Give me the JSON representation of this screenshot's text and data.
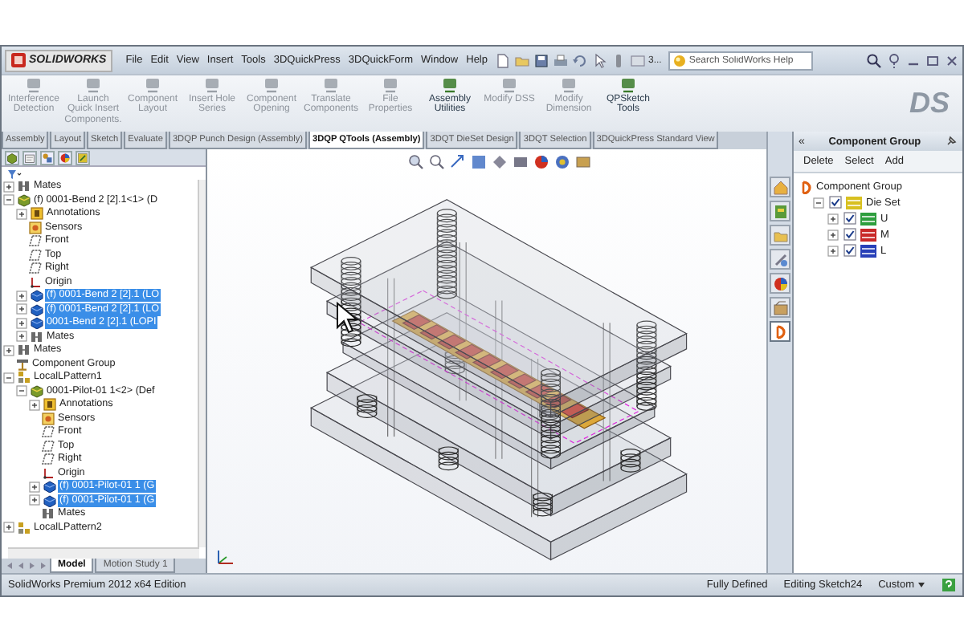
{
  "titlebar": {
    "logo": "SOLIDWORKS",
    "menu": [
      "File",
      "Edit",
      "View",
      "Insert",
      "Tools",
      "3DQuickPress",
      "3DQuickForm",
      "Window",
      "Help"
    ],
    "quick_access_text": "3...",
    "search": {
      "placeholder": "Search SolidWorks Help"
    }
  },
  "ribbon": {
    "commands": [
      {
        "label": "Interference Detection",
        "disabled": true
      },
      {
        "label": "Launch Quick Insert Components.",
        "disabled": true
      },
      {
        "label": "Component Layout",
        "disabled": true
      },
      {
        "label": "Insert Hole Series",
        "disabled": true
      },
      {
        "label": "Component Opening",
        "disabled": true
      },
      {
        "label": "Translate Components",
        "disabled": true
      },
      {
        "label": "File Properties",
        "disabled": true
      },
      {
        "label": "Assembly Utilities",
        "disabled": false
      },
      {
        "label": "Modify DSS",
        "disabled": true
      },
      {
        "label": "Modify Dimension",
        "disabled": true
      },
      {
        "label": "QPSketch Tools",
        "disabled": false
      }
    ],
    "brand_mark": "DS"
  },
  "tabs": [
    {
      "label": "Assembly",
      "selected": false
    },
    {
      "label": "Layout",
      "selected": false
    },
    {
      "label": "Sketch",
      "selected": false
    },
    {
      "label": "Evaluate",
      "selected": false
    },
    {
      "label": "3DQP Punch Design (Assembly)",
      "selected": false
    },
    {
      "label": "3DQP QTools (Assembly)",
      "selected": true
    },
    {
      "label": "3DQT DieSet Design",
      "selected": false
    },
    {
      "label": "3DQT Selection",
      "selected": false
    },
    {
      "label": "3DQuickPress Standard View",
      "selected": false
    }
  ],
  "feature_tree": {
    "items": [
      {
        "label": "Mates",
        "kind": "mates",
        "selected": false,
        "expanded": false
      },
      {
        "label": "(f) 0001-Bend 2 [2].1<1> (D",
        "kind": "assembly",
        "selected": false,
        "expanded": true,
        "children": [
          {
            "label": "Annotations",
            "kind": "annotations",
            "selected": false,
            "expanded": false
          },
          {
            "label": "Sensors",
            "kind": "sensors",
            "selected": false
          },
          {
            "label": "Front",
            "kind": "plane",
            "selected": false
          },
          {
            "label": "Top",
            "kind": "plane",
            "selected": false
          },
          {
            "label": "Right",
            "kind": "plane",
            "selected": false
          },
          {
            "label": "Origin",
            "kind": "origin",
            "selected": false
          },
          {
            "label": "(f) 0001-Bend 2 [2].1 (LO",
            "kind": "part",
            "selected": true,
            "expanded": false
          },
          {
            "label": "(f) 0001-Bend 2 [2].1 (LO",
            "kind": "part",
            "selected": true,
            "expanded": false
          },
          {
            "label": "0001-Bend 2 [2].1 (LOPI",
            "kind": "part",
            "selected": true,
            "expanded": false
          },
          {
            "label": "Mates",
            "kind": "mates",
            "selected": false,
            "expanded": false
          }
        ]
      },
      {
        "label": "Mates",
        "kind": "mates",
        "selected": false,
        "expanded": false
      },
      {
        "label": "Component Group",
        "kind": "group",
        "selected": false
      },
      {
        "label": "LocalLPattern1",
        "kind": "pattern",
        "selected": false,
        "expanded": true,
        "children": [
          {
            "label": "0001-Pilot-01 1<2> (Def",
            "kind": "assembly",
            "selected": false,
            "expanded": true,
            "children": [
              {
                "label": "Annotations",
                "kind": "annotations",
                "selected": false,
                "expanded": false
              },
              {
                "label": "Sensors",
                "kind": "sensors",
                "selected": false
              },
              {
                "label": "Front",
                "kind": "plane",
                "selected": false
              },
              {
                "label": "Top",
                "kind": "plane",
                "selected": false
              },
              {
                "label": "Right",
                "kind": "plane",
                "selected": false
              },
              {
                "label": "Origin",
                "kind": "origin",
                "selected": false
              },
              {
                "label": "(f) 0001-Pilot-01 1 (G",
                "kind": "part",
                "selected": true,
                "expanded": false
              },
              {
                "label": "(f) 0001-Pilot-01 1 (G",
                "kind": "part",
                "selected": true,
                "expanded": false
              },
              {
                "label": "Mates",
                "kind": "mates",
                "selected": false
              }
            ]
          }
        ]
      },
      {
        "label": "LocalLPattern2",
        "kind": "pattern",
        "selected": false,
        "expanded": false
      }
    ]
  },
  "bottom_tabs": [
    {
      "label": "Model",
      "selected": true
    },
    {
      "label": "Motion Study 1",
      "selected": false
    }
  ],
  "task_pane_tabs": [
    {
      "kind": "home",
      "selected": false
    },
    {
      "kind": "library",
      "selected": false
    },
    {
      "kind": "folder",
      "selected": false
    },
    {
      "kind": "tools",
      "selected": false
    },
    {
      "kind": "appearance",
      "selected": false
    },
    {
      "kind": "properties",
      "selected": false
    },
    {
      "kind": "group",
      "selected": true
    }
  ],
  "component_panel": {
    "collapse_glyph": "«",
    "title": "Component Group",
    "buttons": [
      "Delete",
      "Select",
      "Add"
    ],
    "root": {
      "label": "Component Group",
      "children": [
        {
          "label": "Die Set",
          "checked": true,
          "expanded": true,
          "color": "#d8c020",
          "children": [
            {
              "label": "U",
              "checked": true,
              "expanded": false,
              "color": "#2e9e3e"
            },
            {
              "label": "M",
              "checked": true,
              "expanded": false,
              "color": "#c82828"
            },
            {
              "label": "L",
              "checked": true,
              "expanded": false,
              "color": "#2840b8"
            }
          ]
        }
      ]
    }
  },
  "status_bar": {
    "edition": "SolidWorks Premium 2012 x64 Edition",
    "fields": [
      "Fully Defined",
      "Editing Sketch24"
    ],
    "units": "Custom"
  }
}
